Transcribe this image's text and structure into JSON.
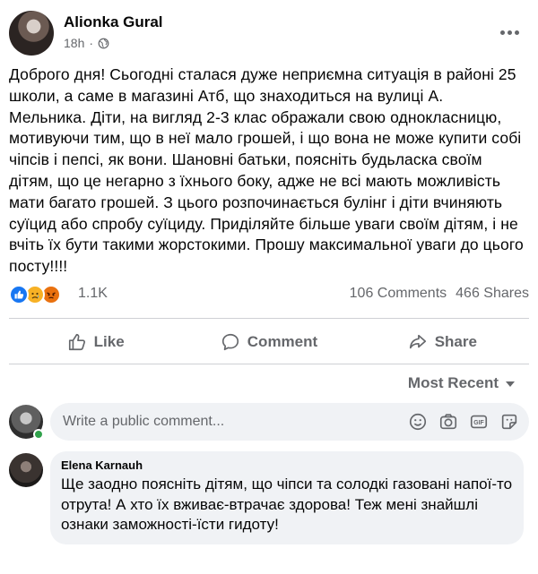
{
  "post": {
    "author": "Alionka Gural",
    "time": "18h",
    "privacy_dot": "·",
    "privacy_icon": "globe-icon",
    "text": "Доброго дня! Сьогодні сталася дуже неприємна ситуація в районі 25 школи, а саме в магазині Атб, що знаходиться на вулиці А. Мельника. Діти, на вигляд 2-3 клас ображали свою однокласницю, мотивуючи тим, що в неї мало грошей, і що вона не може купити собі чіпсів і пепсі, як вони. Шановні батьки, поясніть будьласка своїм дітям, що це негарно з їхнього боку, адже не всі мають можливість мати багато грошей. З цього розпочинається булінг і діти вчиняють суїцид або спробу суїциду. Приділяйте більше уваги своїм дітям, і не вчіть їх бути такими жорстокими. Прошу максимальної уваги до цього посту!!!!",
    "reactions_count": "1.1K",
    "reaction_types": [
      "like",
      "sad",
      "angry"
    ],
    "comments_count": "106 Comments",
    "shares_count": "466 Shares"
  },
  "actions": {
    "like": "Like",
    "comment": "Comment",
    "share": "Share"
  },
  "sort": {
    "label": "Most Recent"
  },
  "composer": {
    "placeholder": "Write a public comment..."
  },
  "comments": [
    {
      "author": "Elena Karnauh",
      "text": "Ще заодно поясніть дітям, що чіпси та солодкі газовані напої-то отрута! А хто їх вживає-втрачає здорова! Теж мені знайшлі ознаки заможності-їсти гидоту!"
    }
  ],
  "colors": {
    "secondary_text": "#65676b",
    "bubble_bg": "#f0f2f5",
    "like_blue": "#1877f2",
    "sad_yellow": "#f7b125",
    "angry_orange": "#e9710f",
    "online_green": "#31a24c"
  }
}
